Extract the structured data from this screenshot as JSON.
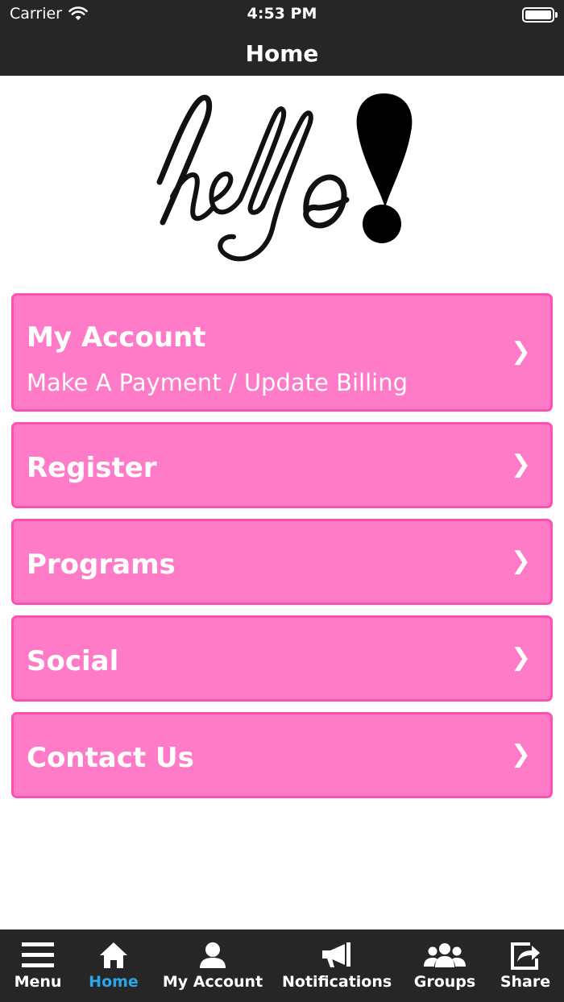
{
  "status_bar": {
    "carrier": "Carrier",
    "time": "4:53 PM"
  },
  "nav": {
    "title": "Home"
  },
  "logo": {
    "text": "hello!"
  },
  "menu": {
    "items": [
      {
        "label": "My Account",
        "subtitle": "Make A Payment / Update Billing",
        "chevron": "❯"
      },
      {
        "label": "Register",
        "chevron": "❯"
      },
      {
        "label": "Programs",
        "chevron": "❯"
      },
      {
        "label": "Social",
        "chevron": "❯"
      },
      {
        "label": "Contact Us",
        "chevron": "❯"
      }
    ]
  },
  "tab_bar": {
    "tabs": [
      {
        "label": "Menu",
        "icon": "hamburger-icon"
      },
      {
        "label": "Home",
        "icon": "home-icon",
        "active": true
      },
      {
        "label": "My Account",
        "icon": "user-icon"
      },
      {
        "label": "Notifications",
        "icon": "megaphone-icon"
      },
      {
        "label": "Groups",
        "icon": "groups-icon"
      },
      {
        "label": "Share",
        "icon": "share-icon"
      }
    ]
  },
  "colors": {
    "bar_background": "#262626",
    "menu_fill": "#ff7ac7",
    "menu_border": "#ff4fb1",
    "active_tab": "#2aa7e8"
  }
}
